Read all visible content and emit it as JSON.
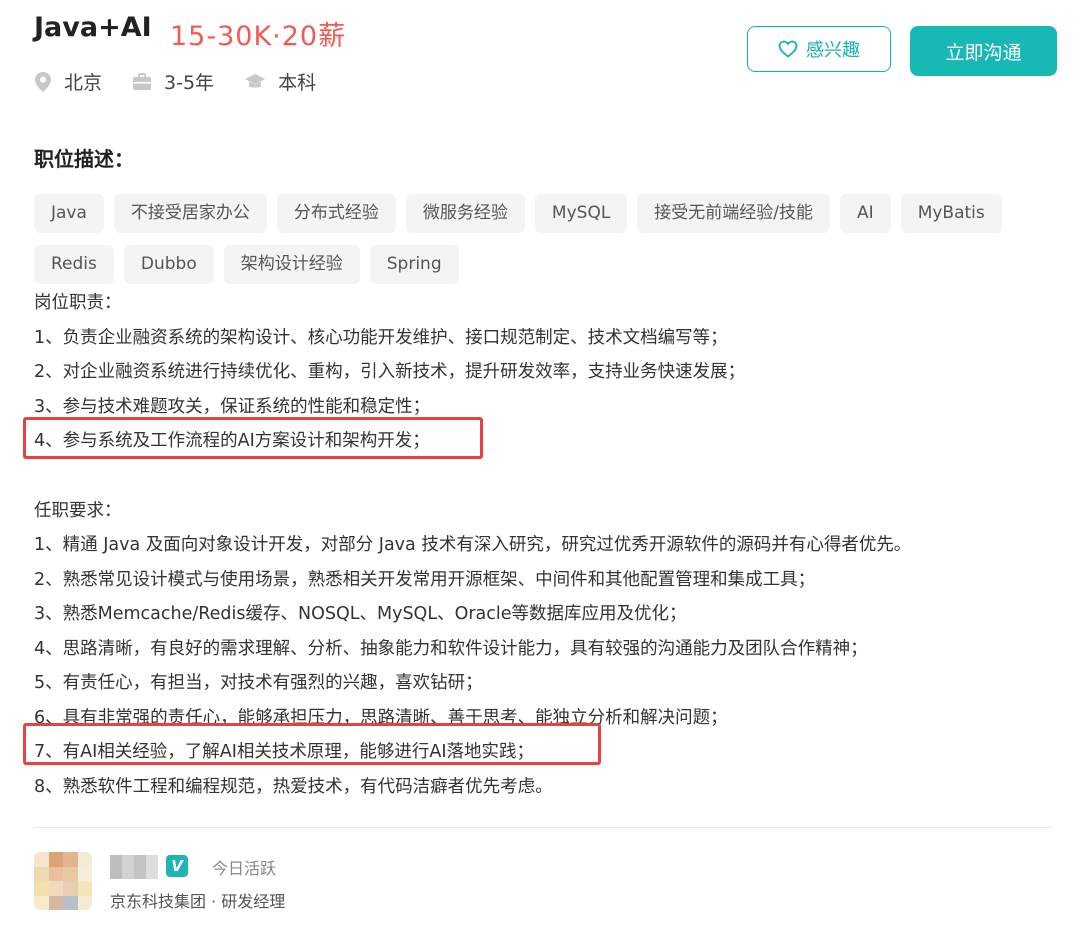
{
  "job": {
    "title": "Java+AI",
    "salary": "15-30K·20薪"
  },
  "meta": {
    "location": "北京",
    "experience": "3-5年",
    "education": "本科"
  },
  "actions": {
    "follow_label": "感兴趣",
    "chat_label": "立即沟通"
  },
  "section": {
    "title": "职位描述："
  },
  "tags": [
    "Java",
    "不接受居家办公",
    "分布式经验",
    "微服务经验",
    "MySQL",
    "接受无前端经验/技能",
    "AI",
    "MyBatis",
    "Redis",
    "Dubbo",
    "架构设计经验",
    "Spring"
  ],
  "duties": {
    "heading": "岗位职责：",
    "items": [
      "1、负责企业融资系统的架构设计、核心功能开发维护、接口规范制定、技术文档编写等；",
      "2、对企业融资系统进行持续优化、重构，引入新技术，提升研发效率，支持业务快速发展；",
      "3、参与技术难题攻关，保证系统的性能和稳定性；",
      "4、参与系统及工作流程的AI方案设计和架构开发；"
    ]
  },
  "requirements": {
    "heading": "任职要求：",
    "items": [
      "1、精通 Java 及面向对象设计开发，对部分 Java 技术有深入研究，研究过优秀开源软件的源码并有心得者优先。",
      "2、熟悉常见设计模式与使用场景，熟悉相关开发常用开源框架、中间件和其他配置管理和集成工具；",
      "3、熟悉Memcache/Redis缓存、NOSQL、MySQL、Oracle等数据库应用及优化；",
      "4、思路清晰，有良好的需求理解、分析、抽象能力和软件设计能力，具有较强的沟通能力及团队合作精神；",
      "5、有责任心，有担当，对技术有强烈的兴趣，喜欢钻研；",
      "6、具有非常强的责任心，能够承担压力，思路清晰、善于思考、能独立分析和解决问题；",
      "7、有AI相关经验，了解AI相关技术原理，能够进行AI落地实践；",
      "8、熟悉软件工程和编程规范，热爱技术，有代码洁癖者优先考虑。"
    ]
  },
  "recruiter": {
    "verified_badge": "V",
    "active_status": "今日活跃",
    "company_role": "京东科技集团 · 研发经理"
  },
  "colors": {
    "accent": "#18b8b5",
    "salary": "#f25a52",
    "highlight": "#e8413f"
  }
}
